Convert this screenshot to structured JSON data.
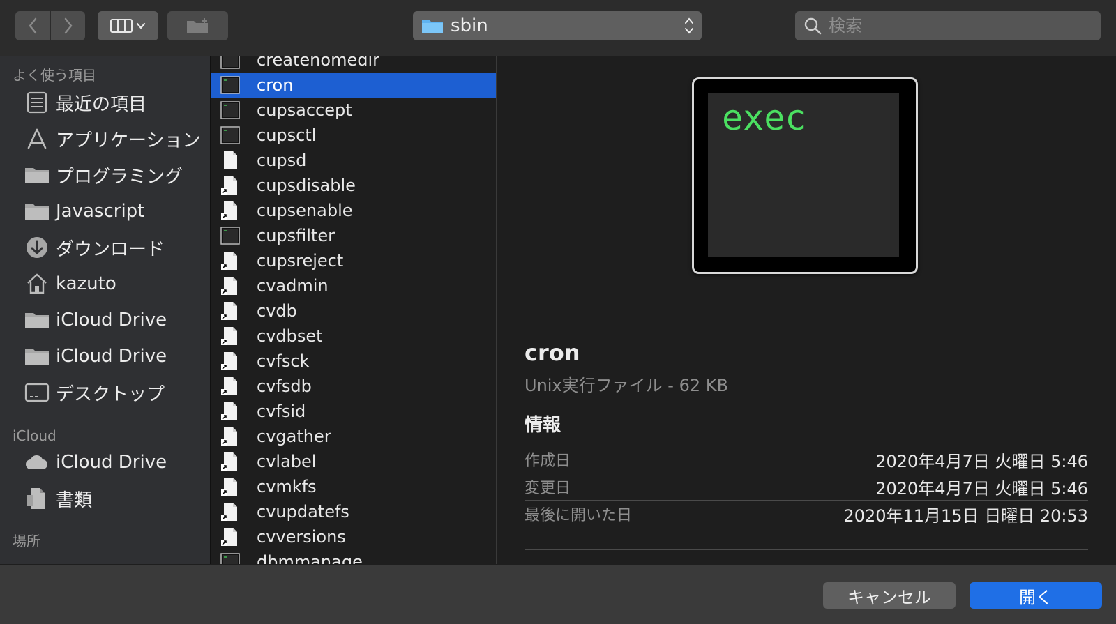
{
  "toolbar": {
    "path": "sbin",
    "search_placeholder": "検索"
  },
  "sidebar": {
    "sections": [
      {
        "header": "よく使う項目",
        "items": [
          {
            "label": "最近の項目",
            "icon": "recents-icon"
          },
          {
            "label": "アプリケーション",
            "icon": "applications-icon"
          },
          {
            "label": "プログラミング",
            "icon": "folder-icon"
          },
          {
            "label": "Javascript",
            "icon": "folder-icon"
          },
          {
            "label": "ダウンロード",
            "icon": "downloads-icon"
          },
          {
            "label": "kazuto",
            "icon": "home-icon"
          },
          {
            "label": "iCloud Drive",
            "icon": "folder-icon"
          },
          {
            "label": "iCloud Drive",
            "icon": "folder-icon"
          },
          {
            "label": "デスクトップ",
            "icon": "desktop-icon"
          }
        ]
      },
      {
        "header": "iCloud",
        "items": [
          {
            "label": "iCloud Drive",
            "icon": "cloud-icon"
          },
          {
            "label": "書類",
            "icon": "documents-icon"
          }
        ]
      },
      {
        "header": "場所",
        "items": []
      }
    ]
  },
  "files": [
    {
      "name": "createhomedir",
      "type": "exec"
    },
    {
      "name": "cron",
      "type": "exec",
      "selected": true
    },
    {
      "name": "cupsaccept",
      "type": "exec"
    },
    {
      "name": "cupsctl",
      "type": "exec"
    },
    {
      "name": "cupsd",
      "type": "doc"
    },
    {
      "name": "cupsdisable",
      "type": "alias"
    },
    {
      "name": "cupsenable",
      "type": "alias"
    },
    {
      "name": "cupsfilter",
      "type": "exec"
    },
    {
      "name": "cupsreject",
      "type": "alias"
    },
    {
      "name": "cvadmin",
      "type": "alias"
    },
    {
      "name": "cvdb",
      "type": "alias"
    },
    {
      "name": "cvdbset",
      "type": "alias"
    },
    {
      "name": "cvfsck",
      "type": "alias"
    },
    {
      "name": "cvfsdb",
      "type": "alias"
    },
    {
      "name": "cvfsid",
      "type": "alias"
    },
    {
      "name": "cvgather",
      "type": "alias"
    },
    {
      "name": "cvlabel",
      "type": "alias"
    },
    {
      "name": "cvmkfs",
      "type": "alias"
    },
    {
      "name": "cvupdatefs",
      "type": "alias"
    },
    {
      "name": "cvversions",
      "type": "alias"
    },
    {
      "name": "dbmmanage",
      "type": "exec"
    }
  ],
  "preview": {
    "icon_text": "exec",
    "name": "cron",
    "kind": "Unix実行ファイル - 62 KB",
    "info_header": "情報",
    "rows": [
      {
        "key": "作成日",
        "value": "2020年4月7日 火曜日 5:46"
      },
      {
        "key": "変更日",
        "value": "2020年4月7日 火曜日 5:46"
      },
      {
        "key": "最後に開いた日",
        "value": "2020年11月15日 日曜日 20:53"
      }
    ]
  },
  "buttons": {
    "cancel": "キャンセル",
    "open": "開く"
  },
  "colors": {
    "selection": "#1d5fd2",
    "primary_button": "#1f6fe6",
    "terminal_text": "#4be061"
  }
}
